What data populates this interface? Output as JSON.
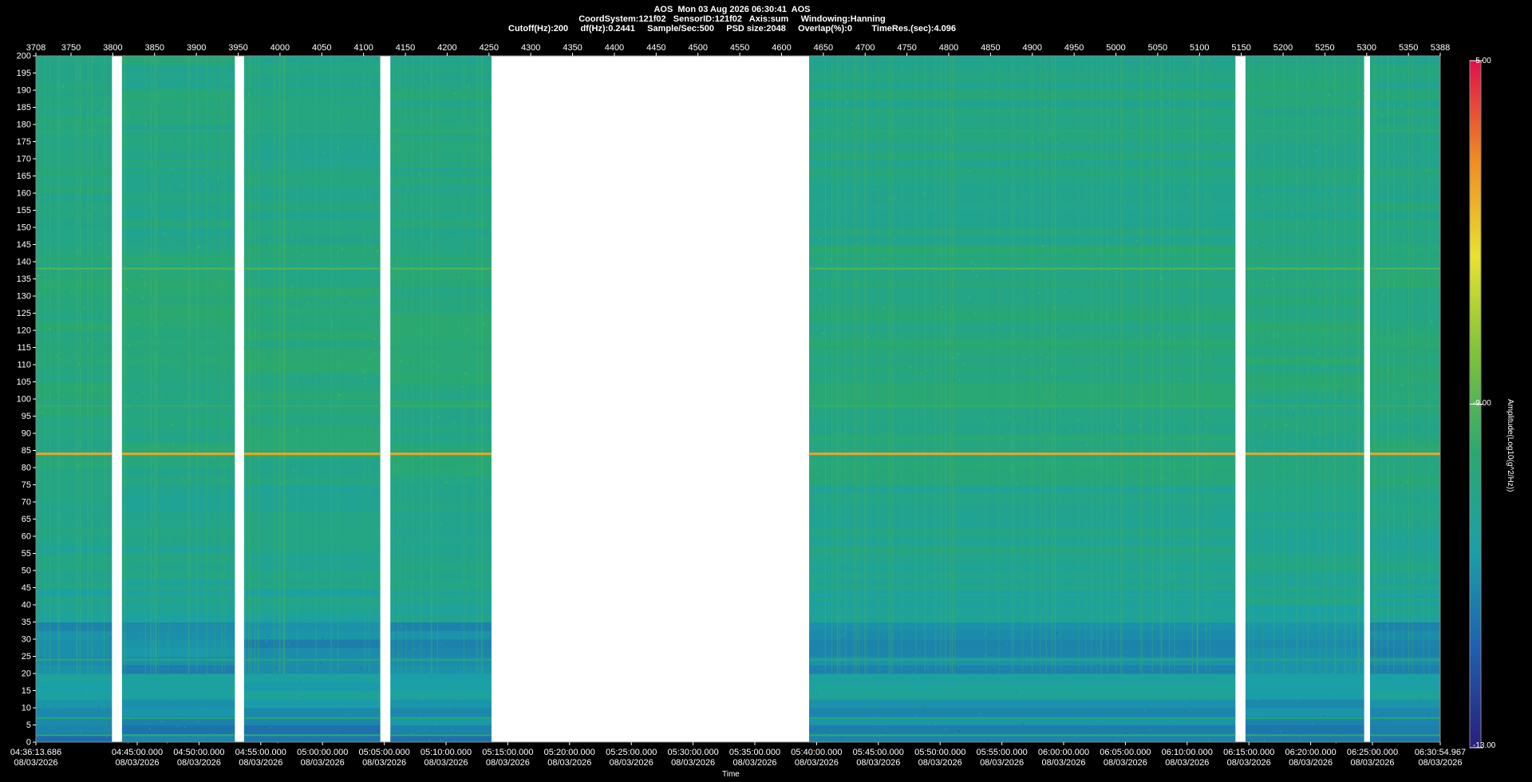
{
  "header": {
    "line1": "AOS  Mon 03 Aug 2026 06:30:41  AOS",
    "line2": "CoordSystem:121f02   SensorID:121f02   Axis:sum     Windowing:Hanning",
    "line3": "Cutoff(Hz):200     df(Hz):0.2441     Sample/Sec:500     PSD size:2048     Overlap(%):0        TimeRes.(sec):4.096"
  },
  "colorbar": {
    "title": "Amplitude(Log10(g^2/Hz))",
    "max_label": "-5.00",
    "mid_label": "-9.00",
    "min_label": "-13.00",
    "colors": [
      "#2a1f7a",
      "#1f5fb0",
      "#1aa0a8",
      "#2aa870",
      "#7cc23a",
      "#e8e22c",
      "#f08a22",
      "#e0104a"
    ]
  },
  "xlabel": "Time",
  "chart_data": {
    "type": "heatmap",
    "title": "AOS  Mon 03 Aug 2026 06:30:41  AOS",
    "ylabel": "",
    "xlabel": "Time",
    "ylim": [
      0,
      200
    ],
    "y_ticks": [
      0,
      5,
      10,
      15,
      20,
      25,
      30,
      35,
      40,
      45,
      50,
      55,
      60,
      65,
      70,
      75,
      80,
      85,
      90,
      95,
      100,
      105,
      110,
      115,
      120,
      125,
      130,
      135,
      140,
      145,
      150,
      155,
      160,
      165,
      170,
      175,
      180,
      185,
      190,
      195,
      200
    ],
    "top_axis_range": [
      3708,
      5388
    ],
    "top_ticks": [
      "3708",
      "3750",
      "3800",
      "3850",
      "3900",
      "3950",
      "4000",
      "4050",
      "4100",
      "4150",
      "4200",
      "4250",
      "4300",
      "4350",
      "4400",
      "4450",
      "4500",
      "4550",
      "4600",
      "4650",
      "4700",
      "4750",
      "4800",
      "4850",
      "4900",
      "4950",
      "5000",
      "5050",
      "5100",
      "5150",
      "5200",
      "5250",
      "5300",
      "5350",
      "5388"
    ],
    "time_ticks": [
      {
        "t": "04:36:13.686",
        "d": "08/03/2026"
      },
      {
        "t": "04:45:00.000",
        "d": "08/03/2026"
      },
      {
        "t": "04:50:00.000",
        "d": "08/03/2026"
      },
      {
        "t": "04:55:00.000",
        "d": "08/03/2026"
      },
      {
        "t": "05:00:00.000",
        "d": "08/03/2026"
      },
      {
        "t": "05:05:00.000",
        "d": "08/03/2026"
      },
      {
        "t": "05:10:00.000",
        "d": "08/03/2026"
      },
      {
        "t": "05:15:00.000",
        "d": "08/03/2026"
      },
      {
        "t": "05:20:00.000",
        "d": "08/03/2026"
      },
      {
        "t": "05:25:00.000",
        "d": "08/03/2026"
      },
      {
        "t": "05:30:00.000",
        "d": "08/03/2026"
      },
      {
        "t": "05:35:00.000",
        "d": "08/03/2026"
      },
      {
        "t": "05:40:00.000",
        "d": "08/03/2026"
      },
      {
        "t": "05:45:00.000",
        "d": "08/03/2026"
      },
      {
        "t": "05:50:00.000",
        "d": "08/03/2026"
      },
      {
        "t": "05:55:00.000",
        "d": "08/03/2026"
      },
      {
        "t": "06:00:00.000",
        "d": "08/03/2026"
      },
      {
        "t": "06:05:00.000",
        "d": "08/03/2026"
      },
      {
        "t": "06:10:00.000",
        "d": "08/03/2026"
      },
      {
        "t": "06:15:00.000",
        "d": "08/03/2026"
      },
      {
        "t": "06:20:00.000",
        "d": "08/03/2026"
      },
      {
        "t": "06:25:00.000",
        "d": "08/03/2026"
      },
      {
        "t": "06:30:54.967",
        "d": "08/03/2026"
      }
    ],
    "data_segments_index": [
      [
        3708,
        3799
      ],
      [
        3811,
        3946
      ],
      [
        3957,
        4120
      ],
      [
        4132,
        4253
      ],
      [
        4633,
        5143
      ],
      [
        5155,
        5297
      ],
      [
        5304,
        5388
      ]
    ],
    "gap_segments_index": [
      [
        3799,
        3811
      ],
      [
        3946,
        3957
      ],
      [
        4120,
        4132
      ],
      [
        4253,
        4633
      ],
      [
        5143,
        5155
      ],
      [
        5297,
        5304
      ]
    ],
    "spectral_lines_hz": [
      {
        "hz": 2,
        "level": -9.5
      },
      {
        "hz": 7,
        "level": -9.8
      },
      {
        "hz": 24,
        "level": -9.8
      },
      {
        "hz": 41.5,
        "level": -9.6
      },
      {
        "hz": 45,
        "level": -9.6
      },
      {
        "hz": 84,
        "level": -6.5
      },
      {
        "hz": 98,
        "level": -9.4
      },
      {
        "hz": 115,
        "level": -9.8
      },
      {
        "hz": 138,
        "level": -9.0
      },
      {
        "hz": 141,
        "level": -9.6
      },
      {
        "hz": 166,
        "level": -9.7
      },
      {
        "hz": 178,
        "level": -9.5
      },
      {
        "hz": 188,
        "level": -9.6
      },
      {
        "hz": 190,
        "level": -9.7
      }
    ],
    "colorbar_range": [
      -13,
      -5
    ],
    "grid": false
  }
}
